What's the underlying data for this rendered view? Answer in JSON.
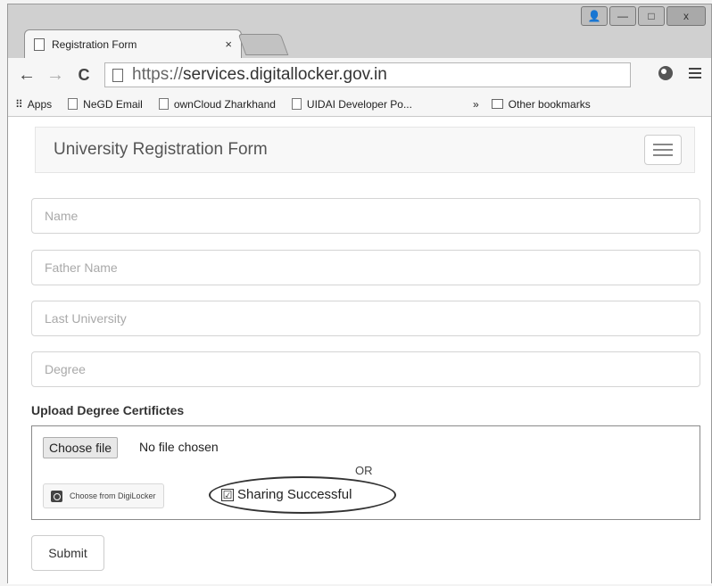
{
  "browser": {
    "tab_title": "Registration Form",
    "tab_close": "×",
    "window_controls": {
      "user": "👤",
      "minimize": "—",
      "maximize": "□",
      "close": "x"
    },
    "nav": {
      "back": "←",
      "forward": "→",
      "reload": "C"
    },
    "url_scheme": "https://",
    "url_host": "services.digitallocker.gov.in",
    "toolbar_icons": [
      "globe-icon",
      "menu-icon"
    ],
    "bookmarks": [
      {
        "label": "Apps",
        "icon": "apps-grid-icon"
      },
      {
        "label": "NeGD Email",
        "icon": "page-icon"
      },
      {
        "label": "ownCloud Zharkhand",
        "icon": "cloud-page-icon"
      },
      {
        "label": "UIDAI Developer Po...",
        "icon": "uidai-icon"
      }
    ],
    "bookmarks_more": "»",
    "other_bookmarks": "Other bookmarks"
  },
  "page": {
    "brand": "University Registration Form",
    "fields": {
      "name_placeholder": "Name",
      "father_placeholder": "Father Name",
      "university_placeholder": "Last University",
      "degree_placeholder": "Degree"
    },
    "upload_label": "Upload Degree Certifictes",
    "choose_file": "Choose file",
    "no_file": "No file chosen",
    "or": "OR",
    "digilocker_button": "Choose from DigiLocker",
    "share_checkbox": "☑",
    "share_status": "Sharing Successful",
    "submit": "Submit"
  }
}
